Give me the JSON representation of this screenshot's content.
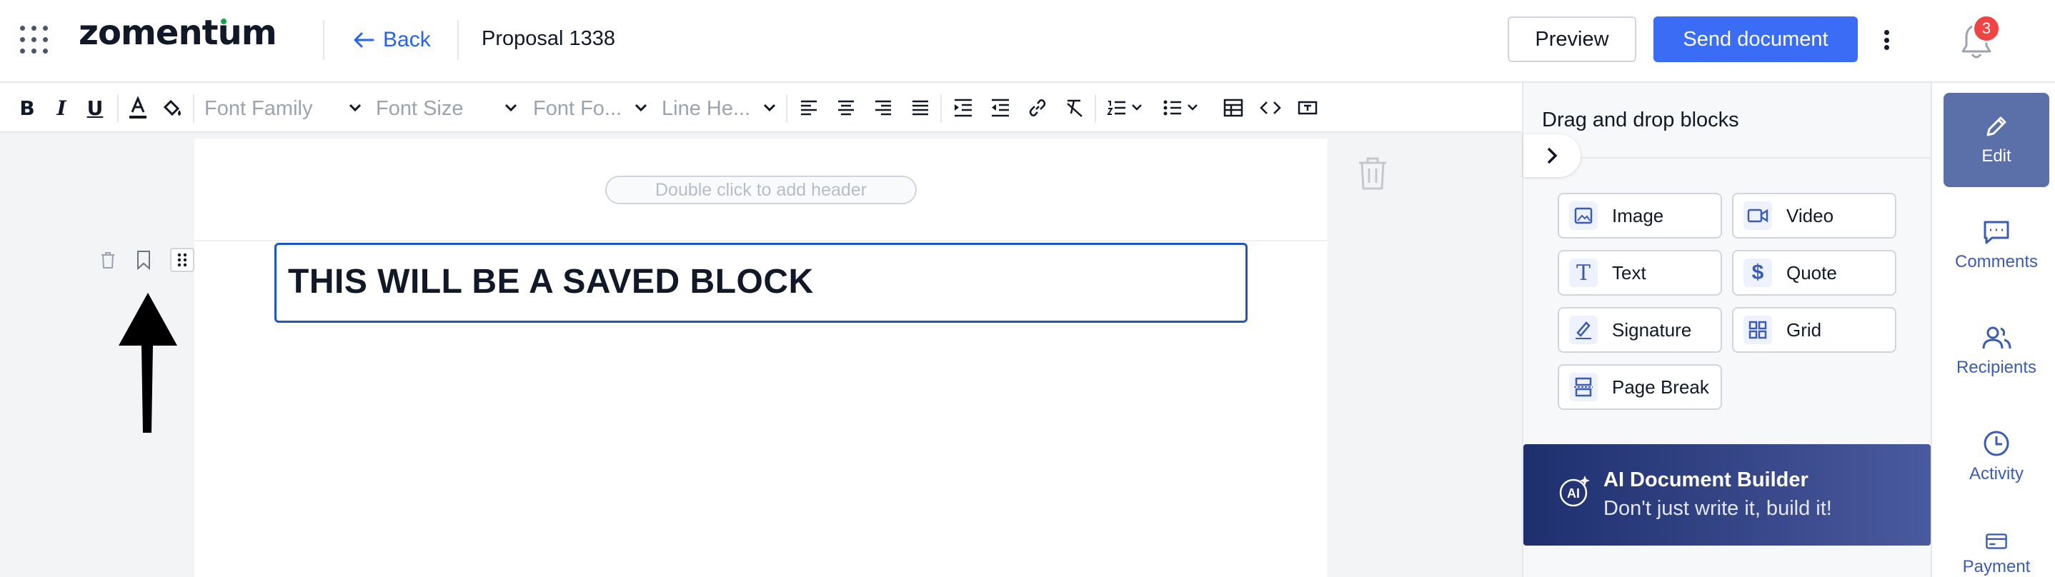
{
  "header": {
    "logo": "zomentum",
    "back_label": "Back",
    "document_title": "Proposal 1338",
    "preview_label": "Preview",
    "send_label": "Send document",
    "notification_count": "3"
  },
  "toolbar": {
    "font_family_placeholder": "Font Family",
    "font_size_placeholder": "Font Size",
    "font_format_placeholder": "Font Fo...",
    "line_height_placeholder": "Line He..."
  },
  "editor": {
    "header_placeholder": "Double click to add header",
    "block_text": "THIS WILL BE A SAVED BLOCK"
  },
  "panel": {
    "title": "Drag and drop blocks",
    "blocks": [
      {
        "label": "Image",
        "icon": "image-icon"
      },
      {
        "label": "Video",
        "icon": "video-icon"
      },
      {
        "label": "Text",
        "icon": "text-icon"
      },
      {
        "label": "Quote",
        "icon": "dollar-icon"
      },
      {
        "label": "Signature",
        "icon": "signature-icon"
      },
      {
        "label": "Grid",
        "icon": "grid-icon"
      },
      {
        "label": "Page Break",
        "icon": "page-break-icon"
      }
    ],
    "ai_title": "AI Document Builder",
    "ai_subtitle": "Don't just write it, build it!"
  },
  "rail": {
    "items": [
      {
        "label": "Edit",
        "icon": "pencil-icon",
        "active": true
      },
      {
        "label": "Comments",
        "icon": "comment-icon",
        "active": false
      },
      {
        "label": "Recipients",
        "icon": "users-icon",
        "active": false
      },
      {
        "label": "Activity",
        "icon": "clock-icon",
        "active": false
      },
      {
        "label": "Payment",
        "icon": "card-icon",
        "active": false
      }
    ]
  },
  "colors": {
    "primary": "#3b6cf6",
    "block_border": "#1e56c8",
    "rail_active": "#5b6fa8",
    "badge": "#ef4444"
  }
}
